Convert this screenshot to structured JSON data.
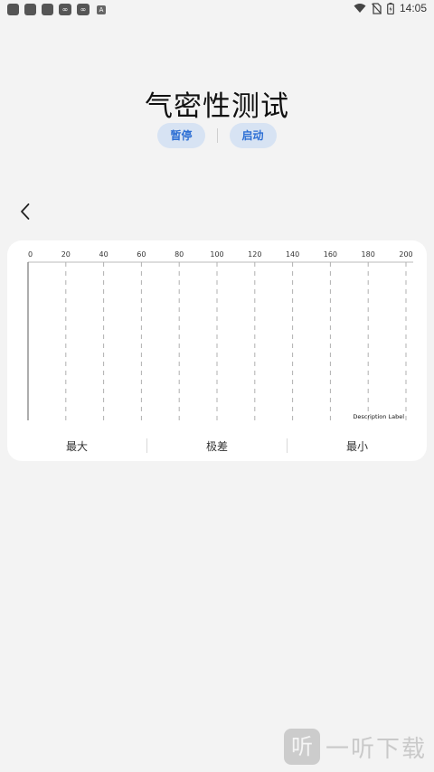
{
  "status_bar": {
    "time": "14:05",
    "app_icons": [
      "app-icon-1",
      "app-icon-2",
      "app-icon-3",
      "app-icon-4",
      "app-icon-5",
      "a-icon"
    ],
    "app_letter": "A",
    "right_icons": [
      "wifi-icon",
      "no-sim-icon",
      "battery-icon"
    ]
  },
  "title": "气密性测试",
  "actions": {
    "pause_label": "暂停",
    "start_label": "启动"
  },
  "chart_data": {
    "type": "line",
    "x_ticks": [
      0,
      20,
      40,
      60,
      80,
      100,
      120,
      140,
      160,
      180,
      200
    ],
    "xlim": [
      0,
      200
    ],
    "series": [],
    "grid": true,
    "grid_style": "dashed",
    "description_label": "Description Label"
  },
  "stats": {
    "max_label": "最大",
    "range_label": "极差",
    "min_label": "最小"
  },
  "watermark": {
    "logo_char": "听",
    "text": "一听下载"
  },
  "colors": {
    "accent": "#2d6fd4",
    "pill_bg": "#d7e3f3",
    "page_bg": "#f3f3f3",
    "card_bg": "#ffffff"
  }
}
